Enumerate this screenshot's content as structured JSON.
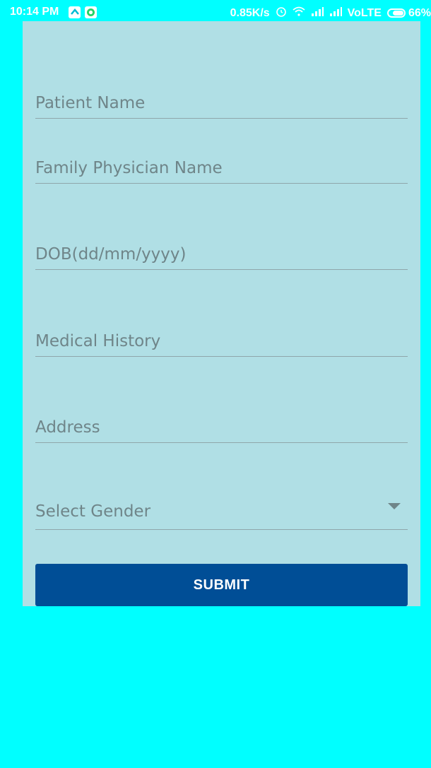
{
  "status_bar": {
    "time": "10:14 PM",
    "network_speed": "0.85K/s",
    "network_type": "VoLTE",
    "battery": "66%",
    "icons": [
      "caret-up-icon",
      "whatsapp-icon",
      "alarm-icon",
      "wifi-icon",
      "signal-icon",
      "signal-icon",
      "battery-icon"
    ]
  },
  "form": {
    "patient_name_placeholder": "Patient Name",
    "physician_name_placeholder": "Family Physician Name",
    "dob_placeholder": "DOB(dd/mm/yyyy)",
    "medical_history_placeholder": "Medical History",
    "address_placeholder": "Address",
    "gender_select": {
      "selected": "Select Gender"
    },
    "submit_label": "SUBMIT"
  },
  "colors": {
    "background": "#00FFFF",
    "panel": "#B0DFE5",
    "button": "#004E96",
    "hint_text": "#6F8589"
  }
}
